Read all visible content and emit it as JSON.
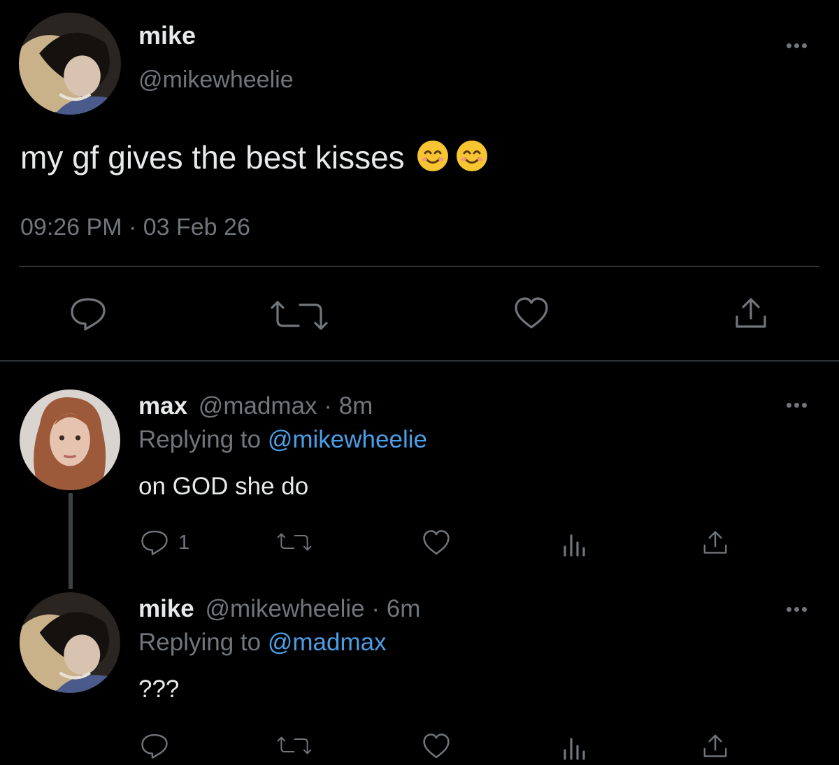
{
  "main_tweet": {
    "display_name": "mike",
    "handle": "@mikewheelie",
    "text": "my gf gives the best kisses",
    "emojis": [
      "smiling-face-icon",
      "smiling-face-icon"
    ],
    "timestamp": "09:26 PM · 03 Feb 26"
  },
  "replies": [
    {
      "display_name": "max",
      "handle": "@madmax",
      "time": "· 8m",
      "replying_prefix": "Replying to",
      "replying_to": "@mikewheelie",
      "text": "on GOD she do",
      "reply_count": "1"
    },
    {
      "display_name": "mike",
      "handle": "@mikewheelie",
      "time": "· 6m",
      "replying_prefix": "Replying to",
      "replying_to": "@madmax",
      "text": "???",
      "reply_count": ""
    }
  ],
  "colors": {
    "background": "#000000",
    "text": "#e7e9ea",
    "muted": "#71767b",
    "link": "#4a9fe8",
    "divider": "#2f3336"
  }
}
